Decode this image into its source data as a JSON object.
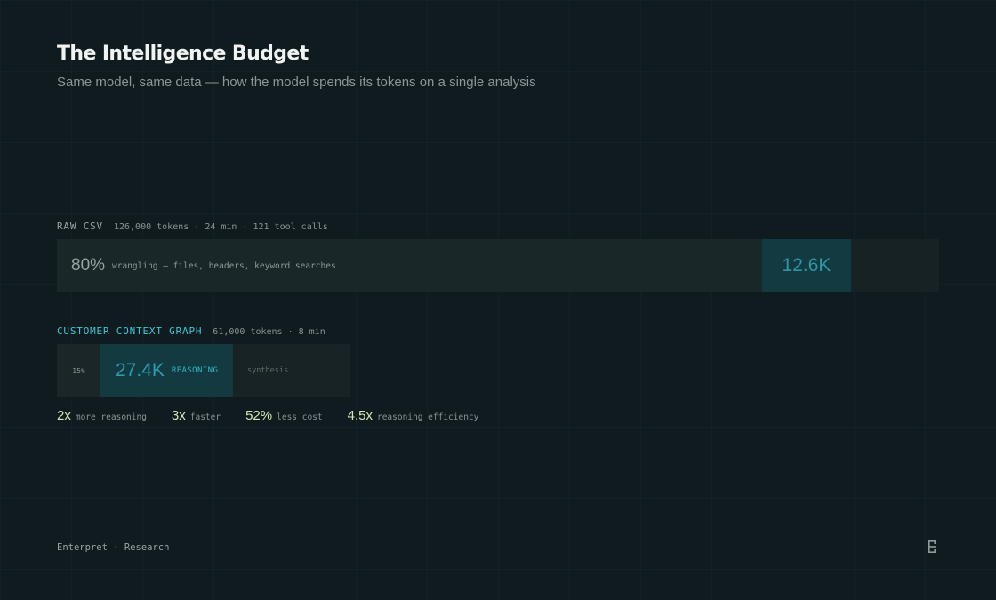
{
  "header": {
    "title": "The Intelligence Budget",
    "subtitle": "Same model, same data — how the model spends its tokens on a single analysis"
  },
  "raw_csv": {
    "name": "RAW CSV",
    "meta": "126,000 tokens · 24 min · 121 tool calls",
    "wrangling_pct": "80%",
    "wrangling_desc": "wrangling — files, headers, keyword searches",
    "reasoning_value": "12.6K",
    "wrangling_fraction": 0.8,
    "reasoning_tokens": 12600,
    "total_tokens": 126000
  },
  "context_graph": {
    "name": "CUSTOMER CONTEXT GRAPH",
    "meta": "61,000 tokens · 8 min",
    "wrangling_pct": "15%",
    "reasoning_value": "27.4K",
    "reasoning_label": "REASONING",
    "synthesis_label": "synthesis",
    "wrangling_fraction": 0.15,
    "reasoning_tokens": 27400,
    "total_tokens": 61000
  },
  "stats": [
    {
      "value": "2x",
      "label": "more reasoning"
    },
    {
      "value": "3x",
      "label": "faster"
    },
    {
      "value": "52%",
      "label": "less cost"
    },
    {
      "value": "4.5x",
      "label": "reasoning efficiency"
    }
  ],
  "footer": {
    "text": "Enterpret · Research"
  },
  "logo_icon": "enterpret-logo-icon",
  "colors": {
    "background": "#0f1b1e",
    "accent_cyan": "#3fc6d8",
    "reasoning_fill": "#133a40",
    "stat_highlight": "#d7e6b5"
  }
}
